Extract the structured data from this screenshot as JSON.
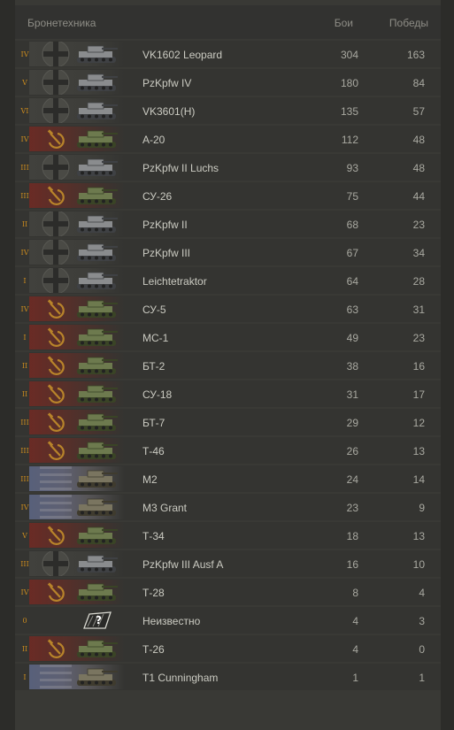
{
  "header": {
    "vehicles_label": "Бронетехника",
    "battles_label": "Бои",
    "wins_label": "Победы"
  },
  "nation_icons": {
    "de": "iron-cross-icon",
    "su": "hammer-sickle-icon",
    "us": "us-flag-icon",
    "none": "unknown-vehicle-icon"
  },
  "colors": {
    "tier": "#c98a1e",
    "text": "#cbcbc2",
    "value": "#a9a9a1",
    "header_text": "#8e8d86"
  },
  "rows": [
    {
      "tier": "IV",
      "nation": "de",
      "name": "VK1602 Leopard",
      "battles": "304",
      "wins": "163"
    },
    {
      "tier": "V",
      "nation": "de",
      "name": "PzKpfw IV",
      "battles": "180",
      "wins": "84"
    },
    {
      "tier": "VI",
      "nation": "de",
      "name": "VK3601(H)",
      "battles": "135",
      "wins": "57"
    },
    {
      "tier": "IV",
      "nation": "su",
      "name": "A-20",
      "battles": "112",
      "wins": "48"
    },
    {
      "tier": "III",
      "nation": "de",
      "name": "PzKpfw II Luchs",
      "battles": "93",
      "wins": "48"
    },
    {
      "tier": "III",
      "nation": "su",
      "name": "СУ-26",
      "battles": "75",
      "wins": "44"
    },
    {
      "tier": "II",
      "nation": "de",
      "name": "PzKpfw II",
      "battles": "68",
      "wins": "23"
    },
    {
      "tier": "IV",
      "nation": "de",
      "name": "PzKpfw III",
      "battles": "67",
      "wins": "34"
    },
    {
      "tier": "I",
      "nation": "de",
      "name": "Leichtetraktor",
      "battles": "64",
      "wins": "28"
    },
    {
      "tier": "IV",
      "nation": "su",
      "name": "СУ-5",
      "battles": "63",
      "wins": "31"
    },
    {
      "tier": "I",
      "nation": "su",
      "name": "МС-1",
      "battles": "49",
      "wins": "23"
    },
    {
      "tier": "II",
      "nation": "su",
      "name": "БТ-2",
      "battles": "38",
      "wins": "16"
    },
    {
      "tier": "II",
      "nation": "su",
      "name": "СУ-18",
      "battles": "31",
      "wins": "17"
    },
    {
      "tier": "III",
      "nation": "su",
      "name": "БТ-7",
      "battles": "29",
      "wins": "12"
    },
    {
      "tier": "III",
      "nation": "su",
      "name": "Т-46",
      "battles": "26",
      "wins": "13"
    },
    {
      "tier": "III",
      "nation": "us",
      "name": "M2",
      "battles": "24",
      "wins": "14"
    },
    {
      "tier": "IV",
      "nation": "us",
      "name": "M3 Grant",
      "battles": "23",
      "wins": "9"
    },
    {
      "tier": "V",
      "nation": "su",
      "name": "Т-34",
      "battles": "18",
      "wins": "13"
    },
    {
      "tier": "III",
      "nation": "de",
      "name": "PzKpfw III Ausf A",
      "battles": "16",
      "wins": "10"
    },
    {
      "tier": "IV",
      "nation": "su",
      "name": "Т-28",
      "battles": "8",
      "wins": "4"
    },
    {
      "tier": "0",
      "nation": "none",
      "name": "Неизвестно",
      "battles": "4",
      "wins": "3"
    },
    {
      "tier": "II",
      "nation": "su",
      "name": "Т-26",
      "battles": "4",
      "wins": "0"
    },
    {
      "tier": "I",
      "nation": "us",
      "name": "T1 Cunningham",
      "battles": "1",
      "wins": "1"
    }
  ]
}
